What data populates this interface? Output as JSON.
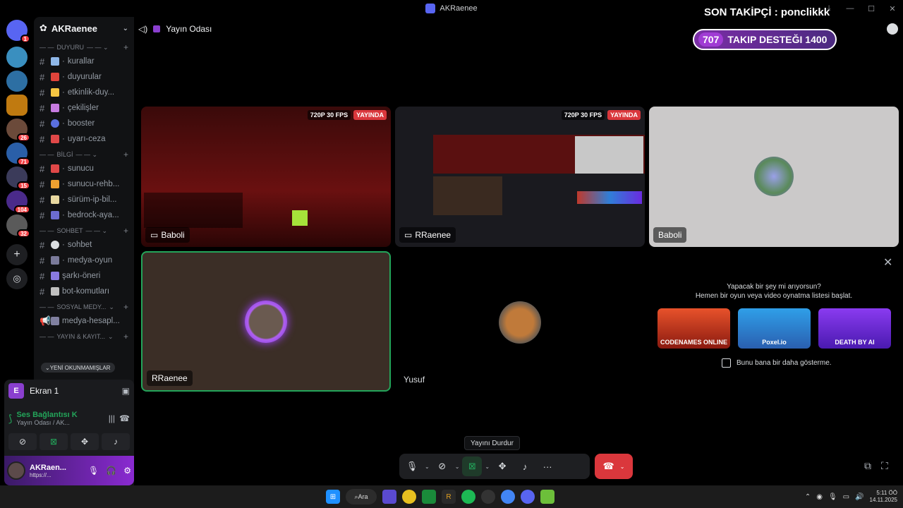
{
  "window": {
    "title": "AKRaenee",
    "controls": [
      "minimize-icon",
      "maximize-icon",
      "close-icon"
    ]
  },
  "overlay": {
    "last_follower": "SON TAKİPÇİ : ponclikkk",
    "goal_current": "707",
    "goal_text": "TAKIP DESTEĞI 1400"
  },
  "rail": {
    "badges": [
      "1",
      "26",
      "71",
      "15",
      "104",
      "32"
    ]
  },
  "server": {
    "name": "AKRaenee",
    "categories": [
      {
        "name": "DUYURU",
        "channels": [
          "kurallar",
          "duyurular",
          "etkinlik-duy...",
          "çekilişler",
          "booster",
          "uyarı-ceza"
        ]
      },
      {
        "name": "BİLGİ",
        "channels": [
          "sunucu",
          "sunucu-rehb...",
          "sürüm-ip-bil...",
          "bedrock-aya..."
        ]
      },
      {
        "name": "SOHBET",
        "channels": [
          "sohbet",
          "medya-oyun",
          "şarkı-öneri",
          "bot-komutları"
        ]
      },
      {
        "name": "SOSYAL MEDY...",
        "channels": [
          "medya-hesapl..."
        ]
      },
      {
        "name": "YAYIN & KAYIT...",
        "channels": []
      }
    ],
    "unread_pill": "YENİ OKUNMAMIŞLAR"
  },
  "panel": {
    "screen_name": "Ekran 1",
    "screen_initial": "E",
    "voice_status": "Ses Bağlantısı K",
    "voice_sub": "Yayın Odası / AK...",
    "user_name": "AKRaen...",
    "user_sub": "https://..."
  },
  "stage": {
    "channel": "Yayın Odası",
    "tiles": [
      {
        "label": "Baboli",
        "quality": "720P 30 FPS",
        "live": "YAYINDA"
      },
      {
        "label": "RRaenee",
        "quality": "720P 30 FPS",
        "live": "YAYINDA"
      },
      {
        "label": "Baboli"
      },
      {
        "label": "RRaenee"
      },
      {
        "label": "Yusuf"
      }
    ]
  },
  "activity": {
    "title_line1": "Yapacak bir şey mi arıyorsun?",
    "title_line2": "Hemen bir oyun veya video oynatma listesi başlat.",
    "cards": [
      {
        "name": "CODENAMES ONLINE",
        "color": "#c0392b"
      },
      {
        "name": "Poxel.io",
        "color": "#2f7fd8"
      },
      {
        "name": "DEATH BY AI",
        "color": "#6a2be0"
      }
    ],
    "dont_show": "Bunu bana bir daha gösterme."
  },
  "controls": {
    "tooltip": "Yayını Durdur"
  },
  "taskbar": {
    "search": "Ara",
    "time": "5:11 ÖÖ",
    "date": "14.11.2025"
  },
  "colors": {
    "accent": "#5865f2",
    "speaking": "#23a55a",
    "live": "#da373c",
    "goal": "#7b2ea6"
  }
}
